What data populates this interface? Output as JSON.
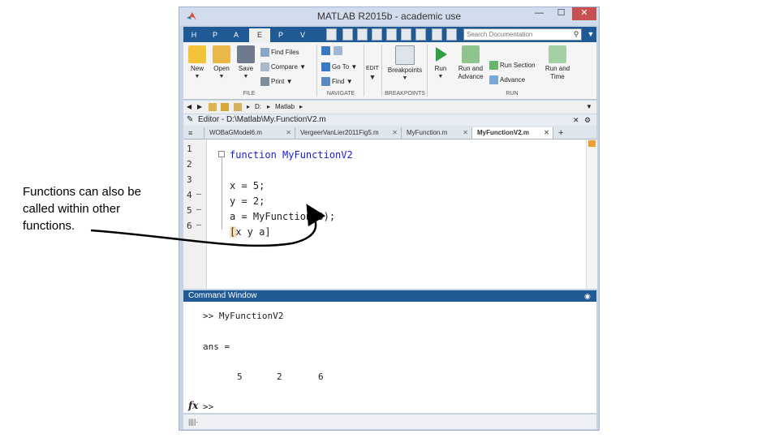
{
  "caption": "Functions can also be called within other functions.",
  "window": {
    "title": "MATLAB R2015b - academic use",
    "min": "—",
    "max": "☐",
    "close": "✕"
  },
  "toolstrip_tabs": [
    "H",
    "P",
    "A",
    "E",
    "P",
    "V"
  ],
  "search": {
    "placeholder": "Search Documentation"
  },
  "ribbon": {
    "file": {
      "label": "FILE",
      "new": "New",
      "open": "Open",
      "save": "Save",
      "find_files": "Find Files",
      "compare": "Compare",
      "print": "Print"
    },
    "navigate": {
      "label": "NAVIGATE",
      "go_to": "Go To",
      "find": "Find"
    },
    "edit": {
      "label": "EDIT"
    },
    "breakpoints": {
      "label": "BREAKPOINTS",
      "button": "Breakpoints"
    },
    "run": {
      "label": "RUN",
      "run": "Run",
      "run_advance_1": "Run and",
      "run_advance_2": "Advance",
      "run_section": "Run Section",
      "advance": "Advance",
      "run_time_1": "Run and",
      "run_time_2": "Time"
    }
  },
  "path": {
    "drive": "D:",
    "folder": "Matlab"
  },
  "editor": {
    "title": "Editor - D:\\Matlab\\My.FunctionV2.m",
    "tabs": [
      {
        "label": "WOBaGModel6.m"
      },
      {
        "label": "VergeerVanLier2011Fig5.m"
      },
      {
        "label": "MyFunction.m"
      },
      {
        "label": "MyFunctionV2.m"
      }
    ],
    "plus": "+",
    "lines": [
      {
        "num": "1",
        "dash": "",
        "text": "function MyFunctionV2"
      },
      {
        "num": "2",
        "dash": "",
        "text": ""
      },
      {
        "num": "3",
        "dash": "",
        "text": "x = 5;"
      },
      {
        "num": "4",
        "dash": "—",
        "text": "y = 2;"
      },
      {
        "num": "5",
        "dash": "—",
        "text": "a = MyFunction(3);"
      },
      {
        "num": "6",
        "dash": "—",
        "text": "[x y a]"
      }
    ]
  },
  "command_window": {
    "title": "Command Window",
    "prompt_line": ">> MyFunctionV2",
    "ans": "ans =",
    "values": [
      "5",
      "2",
      "6"
    ],
    "fx": "fx",
    "prompt": ">>"
  },
  "statusbar": {
    "text": "||||·"
  }
}
